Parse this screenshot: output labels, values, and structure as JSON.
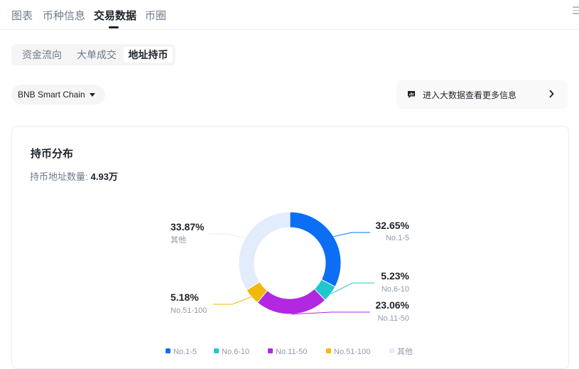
{
  "tabs": [
    "图表",
    "币种信息",
    "交易数据",
    "币圈"
  ],
  "active_tab": "交易数据",
  "subtabs": [
    "资金流向",
    "大单成交",
    "地址持币"
  ],
  "active_subtab": "地址持币",
  "chain_select": {
    "value": "BNB Smart Chain"
  },
  "bigdata_link": {
    "label": "进入大数据查看更多信息"
  },
  "card": {
    "title": "持币分布",
    "count_label": "持币地址数量:",
    "count_value": "4.93万"
  },
  "chart_data": {
    "type": "pie",
    "donut": true,
    "series": [
      {
        "name": "No.1-5",
        "value": 32.65,
        "label": "32.65%",
        "color": "#0b6ef5"
      },
      {
        "name": "No.6-10",
        "value": 5.23,
        "label": "5.23%",
        "color": "#1ec8cc"
      },
      {
        "name": "No.11-50",
        "value": 23.06,
        "label": "23.06%",
        "color": "#b128e0"
      },
      {
        "name": "No.51-100",
        "value": 5.18,
        "label": "5.18%",
        "color": "#f0b90b"
      },
      {
        "name": "其他",
        "value": 33.87,
        "label": "33.87%",
        "color": "#e3ecfa"
      }
    ],
    "legend": [
      "No.1-5",
      "No.6-10",
      "No.11-50",
      "No.51-100",
      "其他"
    ],
    "legend_position": "bottom"
  }
}
